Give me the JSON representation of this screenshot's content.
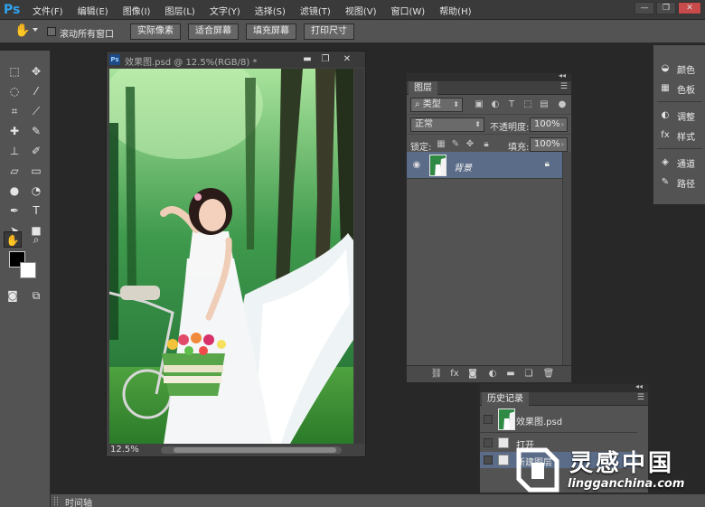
{
  "app": {
    "logo": "Ps"
  },
  "menu": [
    "文件(F)",
    "编辑(E)",
    "图像(I)",
    "图层(L)",
    "文字(Y)",
    "选择(S)",
    "滤镜(T)",
    "视图(V)",
    "窗口(W)",
    "帮助(H)"
  ],
  "window_controls": {
    "minimize": "—",
    "restore": "❐",
    "close": "✕"
  },
  "options_bar": {
    "tool_icon": "hand-icon",
    "scroll_all_label": "滚动所有窗口",
    "buttons": [
      "实际像素",
      "适合屏幕",
      "填充屏幕",
      "打印尺寸"
    ]
  },
  "document": {
    "title": "效果图.psd @ 12.5%(RGB/8) *",
    "ps_badge": "Ps",
    "zoom": "12.5%",
    "controls": {
      "minimize": "▬",
      "restore": "❐",
      "close": "✕"
    }
  },
  "layers_panel": {
    "tab": "图层",
    "filter_label": "类型",
    "blend_mode": "正常",
    "opacity_label": "不透明度:",
    "opacity_value": "100%",
    "lock_label": "锁定:",
    "fill_label": "填充:",
    "fill_value": "100%",
    "layers": [
      {
        "name": "背景",
        "locked": true,
        "visible": true
      }
    ]
  },
  "right_dock": {
    "items": [
      {
        "label": "颜色",
        "icon": "color-icon"
      },
      {
        "label": "色板",
        "icon": "swatches-icon"
      },
      {
        "label": "调整",
        "icon": "adjustments-icon"
      },
      {
        "label": "样式",
        "icon": "styles-icon"
      },
      {
        "label": "通道",
        "icon": "channels-icon"
      },
      {
        "label": "路径",
        "icon": "paths-icon"
      }
    ]
  },
  "history_panel": {
    "tab": "历史记录",
    "snapshot": "效果图.psd",
    "states": [
      "打开",
      "新建图层"
    ]
  },
  "bottom_bar": {
    "label": "时间轴"
  },
  "watermark": {
    "title": "灵感中国",
    "url": "lingganchina.com"
  }
}
